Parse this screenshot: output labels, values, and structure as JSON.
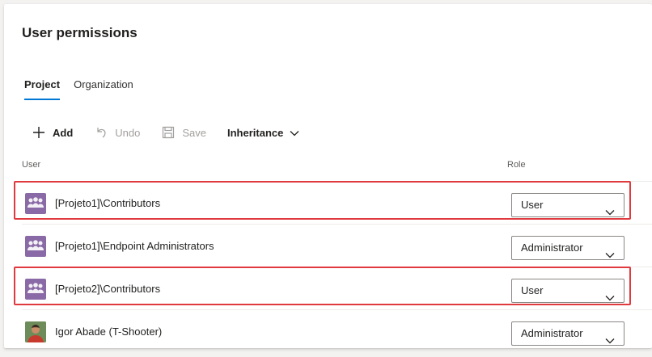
{
  "header": {
    "title": "User permissions"
  },
  "tabs": [
    {
      "label": "Project",
      "active": true
    },
    {
      "label": "Organization",
      "active": false
    }
  ],
  "toolbar": {
    "add_label": "Add",
    "undo_label": "Undo",
    "save_label": "Save",
    "inheritance_label": "Inheritance"
  },
  "table": {
    "columns": {
      "user": "User",
      "role": "Role"
    },
    "rows": [
      {
        "name": "[Projeto1]\\Contributors",
        "role": "User",
        "avatar": "group-icon",
        "highlighted": true
      },
      {
        "name": "[Projeto1]\\Endpoint Administrators",
        "role": "Administrator",
        "avatar": "group-icon",
        "highlighted": false
      },
      {
        "name": "[Projeto2]\\Contributors",
        "role": "User",
        "avatar": "group-icon",
        "highlighted": true
      },
      {
        "name": "Igor Abade (T-Shooter)",
        "role": "Administrator",
        "avatar": "user-photo",
        "highlighted": false
      }
    ]
  },
  "colors": {
    "accent": "#0078d4",
    "highlight": "#e0393e",
    "group_avatar": "#8a6aa6"
  }
}
